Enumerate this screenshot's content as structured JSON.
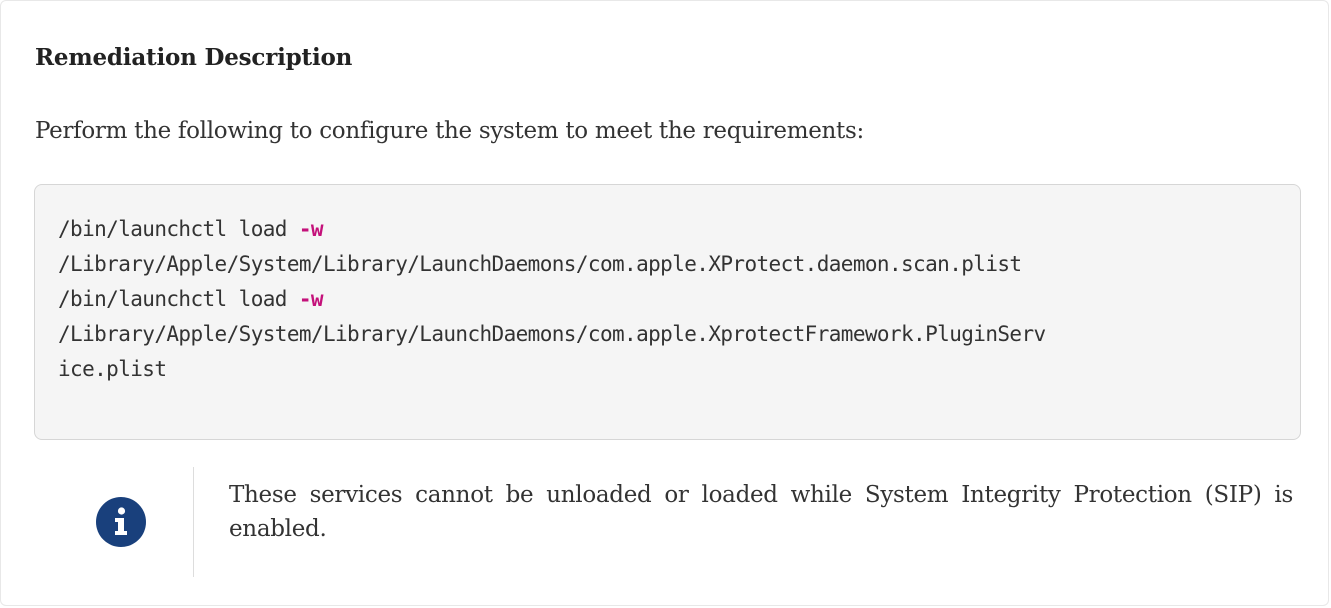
{
  "section": {
    "heading": "Remediation Description",
    "intro": "Perform the following to configure the system to meet the requirements:"
  },
  "code": {
    "lines": [
      {
        "cmd": "/bin/launchctl load ",
        "flag": "-w"
      },
      {
        "path": "/Library/Apple/System/Library/LaunchDaemons/com.apple.XProtect.daemon.scan.plist"
      },
      {
        "cmd": "/bin/launchctl load ",
        "flag": "-w"
      },
      {
        "path": "/Library/Apple/System/Library/LaunchDaemons/com.apple.XprotectFramework.PluginServ"
      },
      {
        "path": "ice.plist"
      }
    ]
  },
  "note": {
    "icon": "info-icon",
    "text": "These services cannot be unloaded or loaded while System Integrity Protection (SIP) is enabled.",
    "icon_color": "#19407c"
  },
  "colors": {
    "flag": "#c4117a",
    "code_bg": "#f5f5f5"
  }
}
